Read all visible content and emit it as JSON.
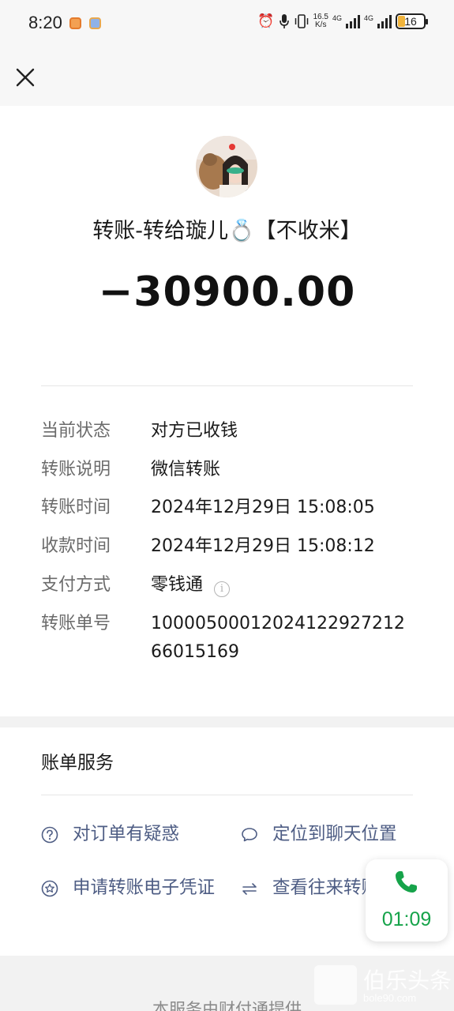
{
  "status_bar": {
    "time": "8:20",
    "net_speed_value": "16.5",
    "net_speed_unit": "K/s",
    "net_type_1": "4G",
    "net_type_2": "4G",
    "battery": "16"
  },
  "header": {
    "close_icon": "close-icon"
  },
  "transfer": {
    "title": "转账-转给璇儿💍【不收米】",
    "amount": "−30900.00"
  },
  "details": [
    {
      "label": "当前状态",
      "value": "对方已收钱"
    },
    {
      "label": "转账说明",
      "value": "微信转账"
    },
    {
      "label": "转账时间",
      "value": "2024年12月29日 15:08:05"
    },
    {
      "label": "收款时间",
      "value": "2024年12月29日 15:08:12"
    },
    {
      "label": "支付方式",
      "value": "零钱通"
    },
    {
      "label": "转账单号",
      "value": "1000050001202412292721266015169"
    }
  ],
  "services": {
    "title": "账单服务",
    "items": [
      {
        "label": "对订单有疑惑",
        "icon": "question-circle-icon"
      },
      {
        "label": "定位到聊天位置",
        "icon": "chat-bubble-icon"
      },
      {
        "label": "申请转账电子凭证",
        "icon": "star-circle-icon"
      },
      {
        "label": "查看往来转账",
        "icon": "swap-arrows-icon"
      }
    ]
  },
  "footer": {
    "text": "本服务由财付通提供"
  },
  "call_widget": {
    "timer": "01:09"
  },
  "watermark": {
    "text": "伯乐头条",
    "sub": "bole90.com"
  },
  "colors": {
    "link": "#4e5d84",
    "call_green": "#16a34a",
    "label_gray": "#6b6b6b"
  }
}
